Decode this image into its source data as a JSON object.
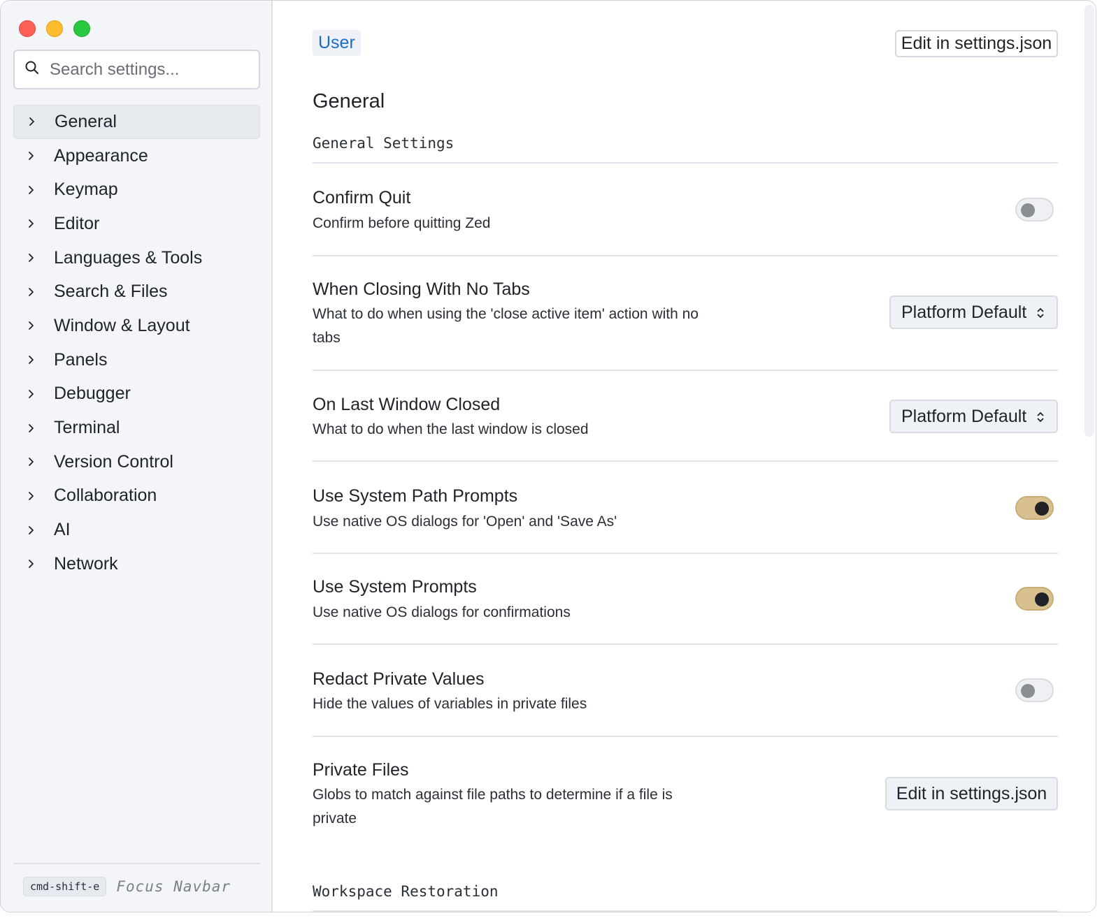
{
  "search": {
    "placeholder": "Search settings..."
  },
  "sidebar": {
    "items": [
      {
        "label": "General"
      },
      {
        "label": "Appearance"
      },
      {
        "label": "Keymap"
      },
      {
        "label": "Editor"
      },
      {
        "label": "Languages & Tools"
      },
      {
        "label": "Search & Files"
      },
      {
        "label": "Window & Layout"
      },
      {
        "label": "Panels"
      },
      {
        "label": "Debugger"
      },
      {
        "label": "Terminal"
      },
      {
        "label": "Version Control"
      },
      {
        "label": "Collaboration"
      },
      {
        "label": "AI"
      },
      {
        "label": "Network"
      }
    ],
    "active": "General",
    "footer": {
      "shortcut": "cmd-shift-e",
      "label": "Focus Navbar"
    }
  },
  "header": {
    "scope_tab": "User",
    "edit_json_label": "Edit in settings.json"
  },
  "main": {
    "section_title": "General",
    "group_title": "General Settings",
    "settings": {
      "confirm_quit": {
        "title": "Confirm Quit",
        "desc": "Confirm before quitting Zed",
        "value": false
      },
      "closing_no_tabs": {
        "title": "When Closing With No Tabs",
        "desc": "What to do when using the 'close active item' action with no tabs",
        "value": "Platform Default"
      },
      "last_window_closed": {
        "title": "On Last Window Closed",
        "desc": "What to do when the last window is closed",
        "value": "Platform Default"
      },
      "system_path_prompts": {
        "title": "Use System Path Prompts",
        "desc": "Use native OS dialogs for 'Open' and 'Save As'",
        "value": true
      },
      "system_prompts": {
        "title": "Use System Prompts",
        "desc": "Use native OS dialogs for confirmations",
        "value": true
      },
      "redact_private": {
        "title": "Redact Private Values",
        "desc": "Hide the values of variables in private files",
        "value": false
      },
      "private_files": {
        "title": "Private Files",
        "desc": "Globs to match against file paths to determine if a file is private",
        "button": "Edit in settings.json"
      }
    },
    "next_group_title": "Workspace Restoration"
  },
  "colors": {
    "accent_link": "#1a6ec9",
    "toggle_on": "#d8c08f",
    "sidebar_bg": "#f3f5f8"
  }
}
